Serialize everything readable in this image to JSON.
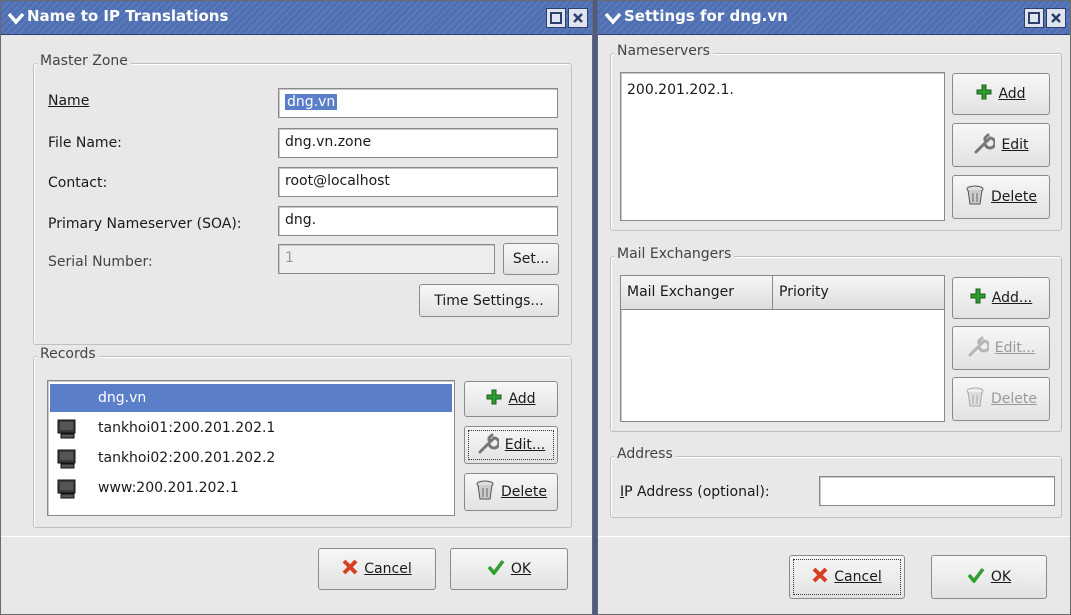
{
  "colors": {
    "titlebar": "#4f6fb3",
    "selection": "#5b7ec9",
    "add_icon": "#2e9e2e",
    "cancel_icon": "#d64020",
    "ok_icon": "#2e9e2e"
  },
  "win1": {
    "title": "Name to IP Translations",
    "master_zone": {
      "label": "Master Zone",
      "name_label": "Name",
      "name_value": "dng.vn",
      "filename_label": "File Name:",
      "filename_value": "dng.vn.zone",
      "contact_label": "Contact:",
      "contact_value": "root@localhost",
      "primary_ns_label": "Primary Nameserver (SOA):",
      "primary_ns_value": "dng.",
      "serial_label": "Serial Number:",
      "serial_value": "1",
      "set_button": "Set...",
      "time_settings_button": "Time Settings..."
    },
    "records": {
      "label": "Records",
      "items": [
        {
          "text": "dng.vn",
          "icon": "none"
        },
        {
          "text": "tankhoi01:200.201.202.1",
          "icon": "computer-icon"
        },
        {
          "text": "tankhoi02:200.201.202.2",
          "icon": "computer-icon"
        },
        {
          "text": "www:200.201.202.1",
          "icon": "computer-icon"
        }
      ],
      "add_button": "Add",
      "edit_button": "Edit...",
      "delete_button": "Delete"
    },
    "cancel_button": "Cancel",
    "ok_button": "OK"
  },
  "win2": {
    "title": "Settings for dng.vn",
    "nameservers": {
      "label": "Nameservers",
      "items": [
        "200.201.202.1."
      ],
      "add_button": "Add",
      "edit_button": "Edit",
      "delete_button": "Delete"
    },
    "mail_exchangers": {
      "label": "Mail Exchangers",
      "columns": [
        "Mail Exchanger",
        "Priority"
      ],
      "add_button": "Add...",
      "edit_button": "Edit...",
      "delete_button": "Delete"
    },
    "address": {
      "label": "Address",
      "ip_label": "IP Address (optional):",
      "ip_value": ""
    },
    "cancel_button": "Cancel",
    "ok_button": "OK"
  }
}
